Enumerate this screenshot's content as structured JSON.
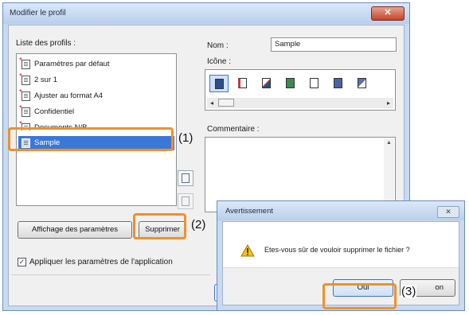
{
  "main_dialog": {
    "title": "Modifier le profil",
    "close_glyph": "✕",
    "profiles_label": "Liste des profils :",
    "profiles": [
      {
        "label": "Paramètres par défaut",
        "starred": true,
        "selected": false
      },
      {
        "label": "2 sur 1",
        "starred": true,
        "selected": false
      },
      {
        "label": "Ajuster au format A4",
        "starred": true,
        "selected": false
      },
      {
        "label": "Confidentiel",
        "starred": true,
        "selected": false
      },
      {
        "label": "Documents N/B",
        "starred": true,
        "selected": false
      },
      {
        "label": "Sample",
        "starred": false,
        "selected": true
      }
    ],
    "name_label": "Nom :",
    "name_value": "Sample",
    "icon_label": "Icône :",
    "comment_label": "Commentaire :",
    "settings_button": "Affichage des paramètres",
    "delete_button": "Supprimer",
    "apply_checkbox_label": "Appliquer les paramètres de l'application",
    "apply_checkbox_checked": true
  },
  "callouts": {
    "step1": "(1)",
    "step2": "(2)",
    "step3": "(3)"
  },
  "warning_dialog": {
    "title": "Avertissement",
    "message": "Etes-vous sûr de vouloir supprimer le fichier ?",
    "yes_button": "Oui",
    "no_button_partial": "on"
  },
  "colors": {
    "highlight": "#f0902a",
    "selection": "#3a78d8"
  }
}
